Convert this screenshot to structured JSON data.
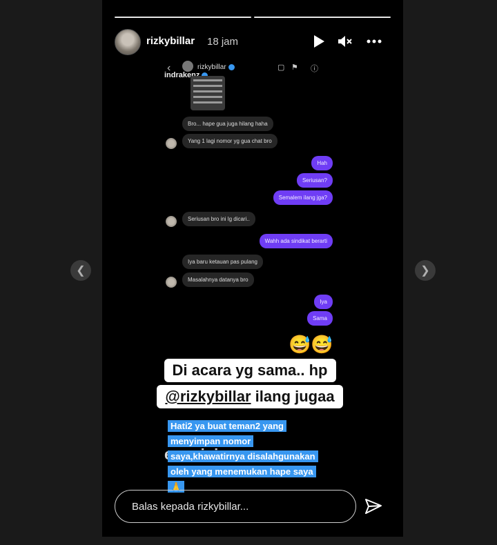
{
  "header": {
    "username": "rizkybillar",
    "time": "18 jam"
  },
  "inner_screenshot": {
    "header_user": "rizkybillar",
    "sub_user": "indrakenz",
    "messages": [
      {
        "side": "in",
        "text": "Bro... hape gua juga hilang haha"
      },
      {
        "side": "in",
        "text": "Yang 1 lagi nomor yg gua chat bro"
      },
      {
        "side": "out",
        "text": "Hah"
      },
      {
        "side": "out",
        "text": "Seriusan?"
      },
      {
        "side": "out",
        "text": "Semalem ilang jga?"
      },
      {
        "side": "in",
        "text": "Seriusan bro ini lg dicari.."
      },
      {
        "side": "out",
        "text": "Wahh ada sindikat berarti"
      },
      {
        "side": "in",
        "text": "Iya baru ketauan pas pulang"
      },
      {
        "side": "in",
        "text": "Masalahnya datanya bro"
      },
      {
        "side": "out",
        "text": "Iya"
      },
      {
        "side": "out",
        "text": "Sama"
      }
    ],
    "emojis": "😅😅"
  },
  "caption": {
    "line1": "Di acara yg sama.. hp",
    "line2_mention": "@rizkybillar",
    "line2_rest": " ilang jugaa",
    "behind_text": "ener ini",
    "highlight_text": "Hati2 ya buat teman2 yang menyimpan nomor saya,khawatirnya disalahgunakan oleh yang menemukan hape saya🙏"
  },
  "reply": {
    "placeholder": "Balas kepada rizkybillar..."
  },
  "colors": {
    "outgoing_bubble": "#6f3df5",
    "incoming_bubble": "#262626",
    "highlight": "#3897f0",
    "verified": "#3897f0"
  }
}
